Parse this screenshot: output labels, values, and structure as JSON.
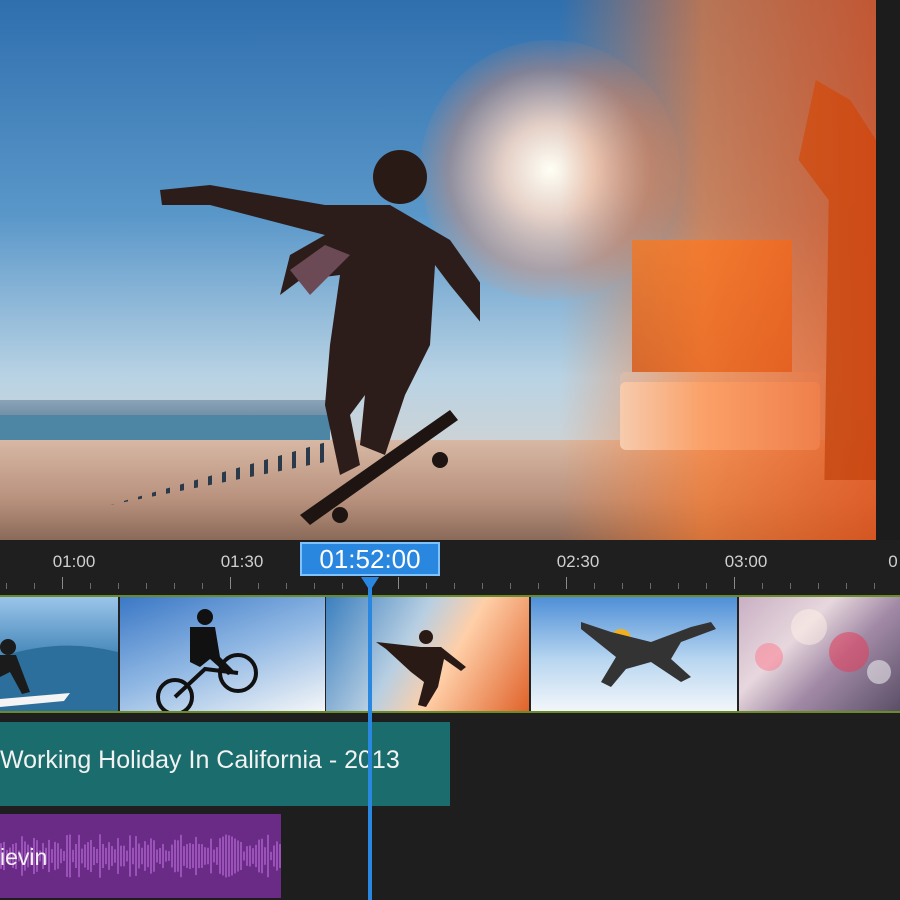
{
  "timeline": {
    "playhead_time": "01:52:00",
    "ruler_labels": [
      "01:00",
      "01:30",
      "02:30",
      "03:00",
      "0"
    ]
  },
  "tracks": {
    "title_clip_label": "Working Holiday In California - 2013",
    "audio_clip_label": "ievin"
  },
  "colors": {
    "playhead": "#2a87e0",
    "title_clip": "#1b6c6c",
    "audio_clip": "#6a2b86",
    "video_track_border": "#6b8a2a"
  }
}
